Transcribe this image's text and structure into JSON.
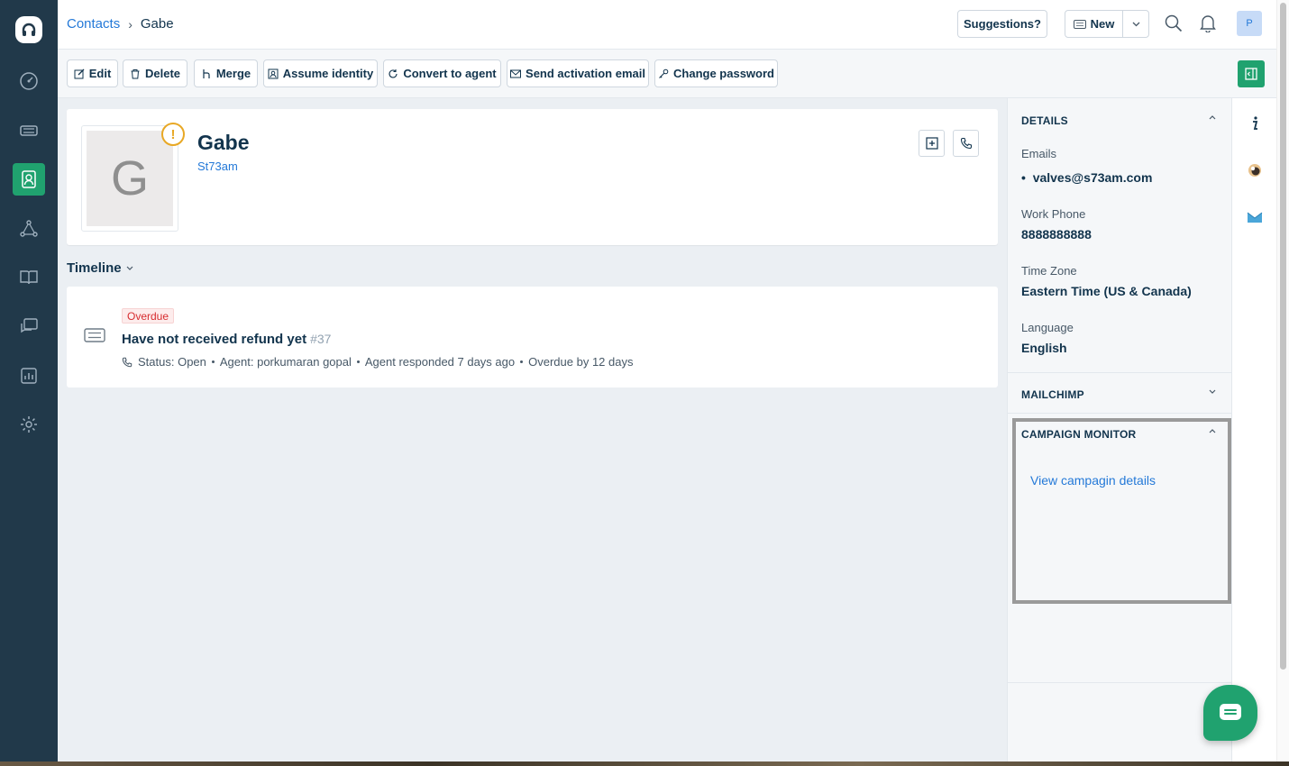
{
  "breadcrumb": {
    "parent": "Contacts",
    "current": "Gabe"
  },
  "header": {
    "suggestions_label": "Suggestions?",
    "new_label": "New",
    "user_initial": "P"
  },
  "actions": {
    "edit": "Edit",
    "delete": "Delete",
    "merge": "Merge",
    "assume_identity": "Assume identity",
    "convert_to_agent": "Convert to agent",
    "send_activation_email": "Send activation email",
    "change_password": "Change password"
  },
  "contact": {
    "initial": "G",
    "name": "Gabe",
    "company": "St73am",
    "warning_glyph": "!"
  },
  "timeline": {
    "label": "Timeline",
    "tickets": [
      {
        "badge": "Overdue",
        "title": "Have not received refund yet",
        "number": "#37",
        "status": "Status: Open",
        "agent": "Agent: porkumaran gopal",
        "responded": "Agent responded 7 days ago",
        "overdue": "Overdue by 12 days"
      }
    ]
  },
  "sidebar": {
    "details_title": "DETAILS",
    "emails_label": "Emails",
    "email_value": "valves@s73am.com",
    "work_phone_label": "Work Phone",
    "work_phone_value": "8888888888",
    "time_zone_label": "Time Zone",
    "time_zone_value": "Eastern Time (US & Canada)",
    "language_label": "Language",
    "language_value": "English",
    "mailchimp_title": "MAILCHIMP",
    "campaign_title": "CAMPAIGN MONITOR",
    "campaign_link": "View campagin details"
  },
  "colors": {
    "nav_bg": "#21394a",
    "accent_green": "#20a26f",
    "link_blue": "#2479d8",
    "overdue_red": "#d72d30",
    "warning_amber": "#e8a825"
  },
  "icons": {
    "left_nav": [
      "dashboard-icon",
      "tickets-icon",
      "contacts-icon",
      "social-icon",
      "solutions-icon",
      "forums-icon",
      "reports-icon",
      "admin-icon"
    ],
    "rail": [
      "info-icon",
      "mailchimp-icon",
      "campaign-monitor-icon"
    ]
  }
}
